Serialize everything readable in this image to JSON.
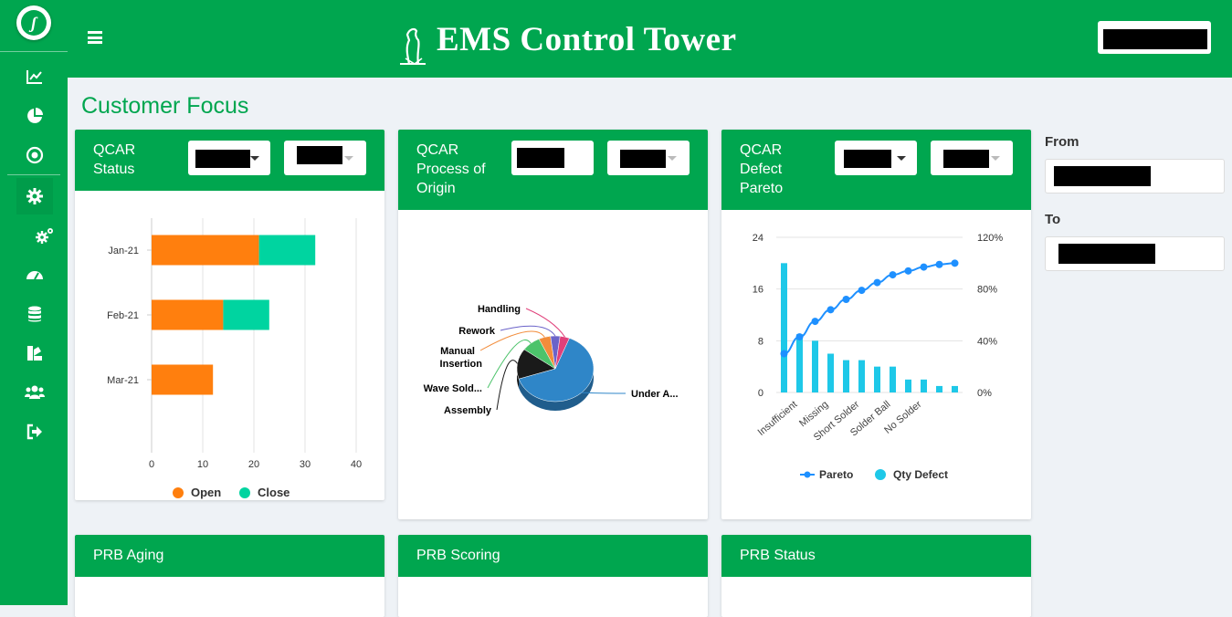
{
  "app": {
    "title": "EMS Control Tower"
  },
  "page": {
    "heading": "Customer Focus"
  },
  "sidebar": {
    "items": [
      {
        "icon": "line-chart-icon"
      },
      {
        "icon": "pie-chart-icon"
      },
      {
        "icon": "target-icon"
      },
      {
        "icon": "gear-icon",
        "active": true
      },
      {
        "icon": "gears-icon"
      },
      {
        "icon": "speedometer-icon"
      },
      {
        "icon": "database-icon"
      },
      {
        "icon": "swatch-icon"
      },
      {
        "icon": "users-icon"
      },
      {
        "icon": "sign-out-icon"
      }
    ]
  },
  "filters": {
    "from_label": "From",
    "to_label": "To"
  },
  "cards": {
    "qcar_status": {
      "title_lines": [
        "QCAR",
        "Status"
      ]
    },
    "qcar_process": {
      "title_lines": [
        "QCAR",
        "Process of",
        "Origin"
      ]
    },
    "qcar_pareto": {
      "title_lines": [
        "QCAR",
        "Defect",
        "Pareto"
      ]
    },
    "prb_aging": {
      "title": "PRB Aging"
    },
    "prb_scoring": {
      "title": "PRB Scoring"
    },
    "prb_status": {
      "title": "PRB Status"
    }
  },
  "colors": {
    "brand": "#00a64f",
    "open": "#ff7f0e",
    "close": "#00d4a0",
    "pareto": "#1e90ff",
    "qty": "#1ec8e8"
  },
  "chart_data": [
    {
      "type": "bar",
      "orientation": "horizontal",
      "stacked": true,
      "categories": [
        "Jan-21",
        "Feb-21",
        "Mar-21"
      ],
      "series": [
        {
          "name": "Open",
          "values": [
            21,
            14,
            12
          ]
        },
        {
          "name": "Close",
          "values": [
            11,
            9,
            0
          ]
        }
      ],
      "xlim": [
        0,
        40
      ],
      "xticks": [
        "0",
        "10",
        "20",
        "30",
        "40"
      ],
      "grid": true,
      "legend": "bottom"
    },
    {
      "type": "pie",
      "style": "3d",
      "slices": [
        {
          "label": "Under A...",
          "value": 64,
          "color": "#2f86c8"
        },
        {
          "label": "Assembly",
          "value": 15,
          "color": "#1a1a1a"
        },
        {
          "label": "Wave Sold...",
          "value": 8,
          "color": "#4cc36b"
        },
        {
          "label": "Manual Insertion",
          "value": 5,
          "color": "#f28c3b"
        },
        {
          "label": "Rework",
          "value": 4,
          "color": "#6b63c9"
        },
        {
          "label": "Handling",
          "value": 4,
          "color": "#e0407a"
        }
      ],
      "legend": "none"
    },
    {
      "type": "bar",
      "categories": [
        "Insufficient",
        "",
        "Missing",
        "",
        "Short Solder",
        "",
        "Solder Ball",
        "",
        "No Solder",
        "",
        ""
      ],
      "series": [
        {
          "name": "Qty Defect",
          "values": [
            20,
            9,
            8,
            6,
            5,
            5,
            4,
            4,
            2,
            2,
            1,
            1
          ],
          "type": "bar",
          "axis": "left"
        },
        {
          "name": "Pareto",
          "values": [
            30,
            43,
            55,
            64,
            72,
            79,
            85,
            91,
            94,
            97,
            99,
            100
          ],
          "type": "line",
          "axis": "right"
        }
      ],
      "x_labels": [
        "Insufficient",
        "Missing",
        "Short Solder",
        "Solder Ball",
        "No Solder"
      ],
      "ylim": [
        0,
        24
      ],
      "yticks": [
        "0",
        "8",
        "16",
        "24"
      ],
      "y2lim": [
        0,
        120
      ],
      "y2ticks": [
        "0%",
        "40%",
        "80%",
        "120%"
      ],
      "legend": "bottom"
    }
  ]
}
